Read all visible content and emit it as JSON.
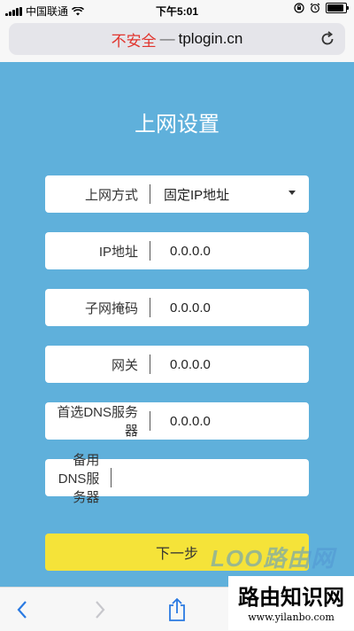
{
  "status_bar": {
    "carrier": "中国联通",
    "time": "下午5:01"
  },
  "address_bar": {
    "insecure_label": "不安全",
    "separator": "—",
    "url": "tplogin.cn"
  },
  "page": {
    "title": "上网设置",
    "fields": [
      {
        "label": "上网方式",
        "value": "固定IP地址"
      },
      {
        "label": "IP地址",
        "value": "0.0.0.0"
      },
      {
        "label": "子网掩码",
        "value": "0.0.0.0"
      },
      {
        "label": "网关",
        "value": "0.0.0.0"
      },
      {
        "label": "首选DNS服务器",
        "value": "0.0.0.0"
      },
      {
        "label": "备用DNS服务器",
        "value": ""
      }
    ],
    "next_button": "下一步"
  },
  "watermark": {
    "faint_text": "LOO路由网",
    "title": "路由知识网",
    "url": "www.yilanbo.com"
  },
  "colors": {
    "background": "#5fb0db",
    "button": "#f5e339",
    "insecure": "#e1352e",
    "accent": "#2a7ae2"
  }
}
